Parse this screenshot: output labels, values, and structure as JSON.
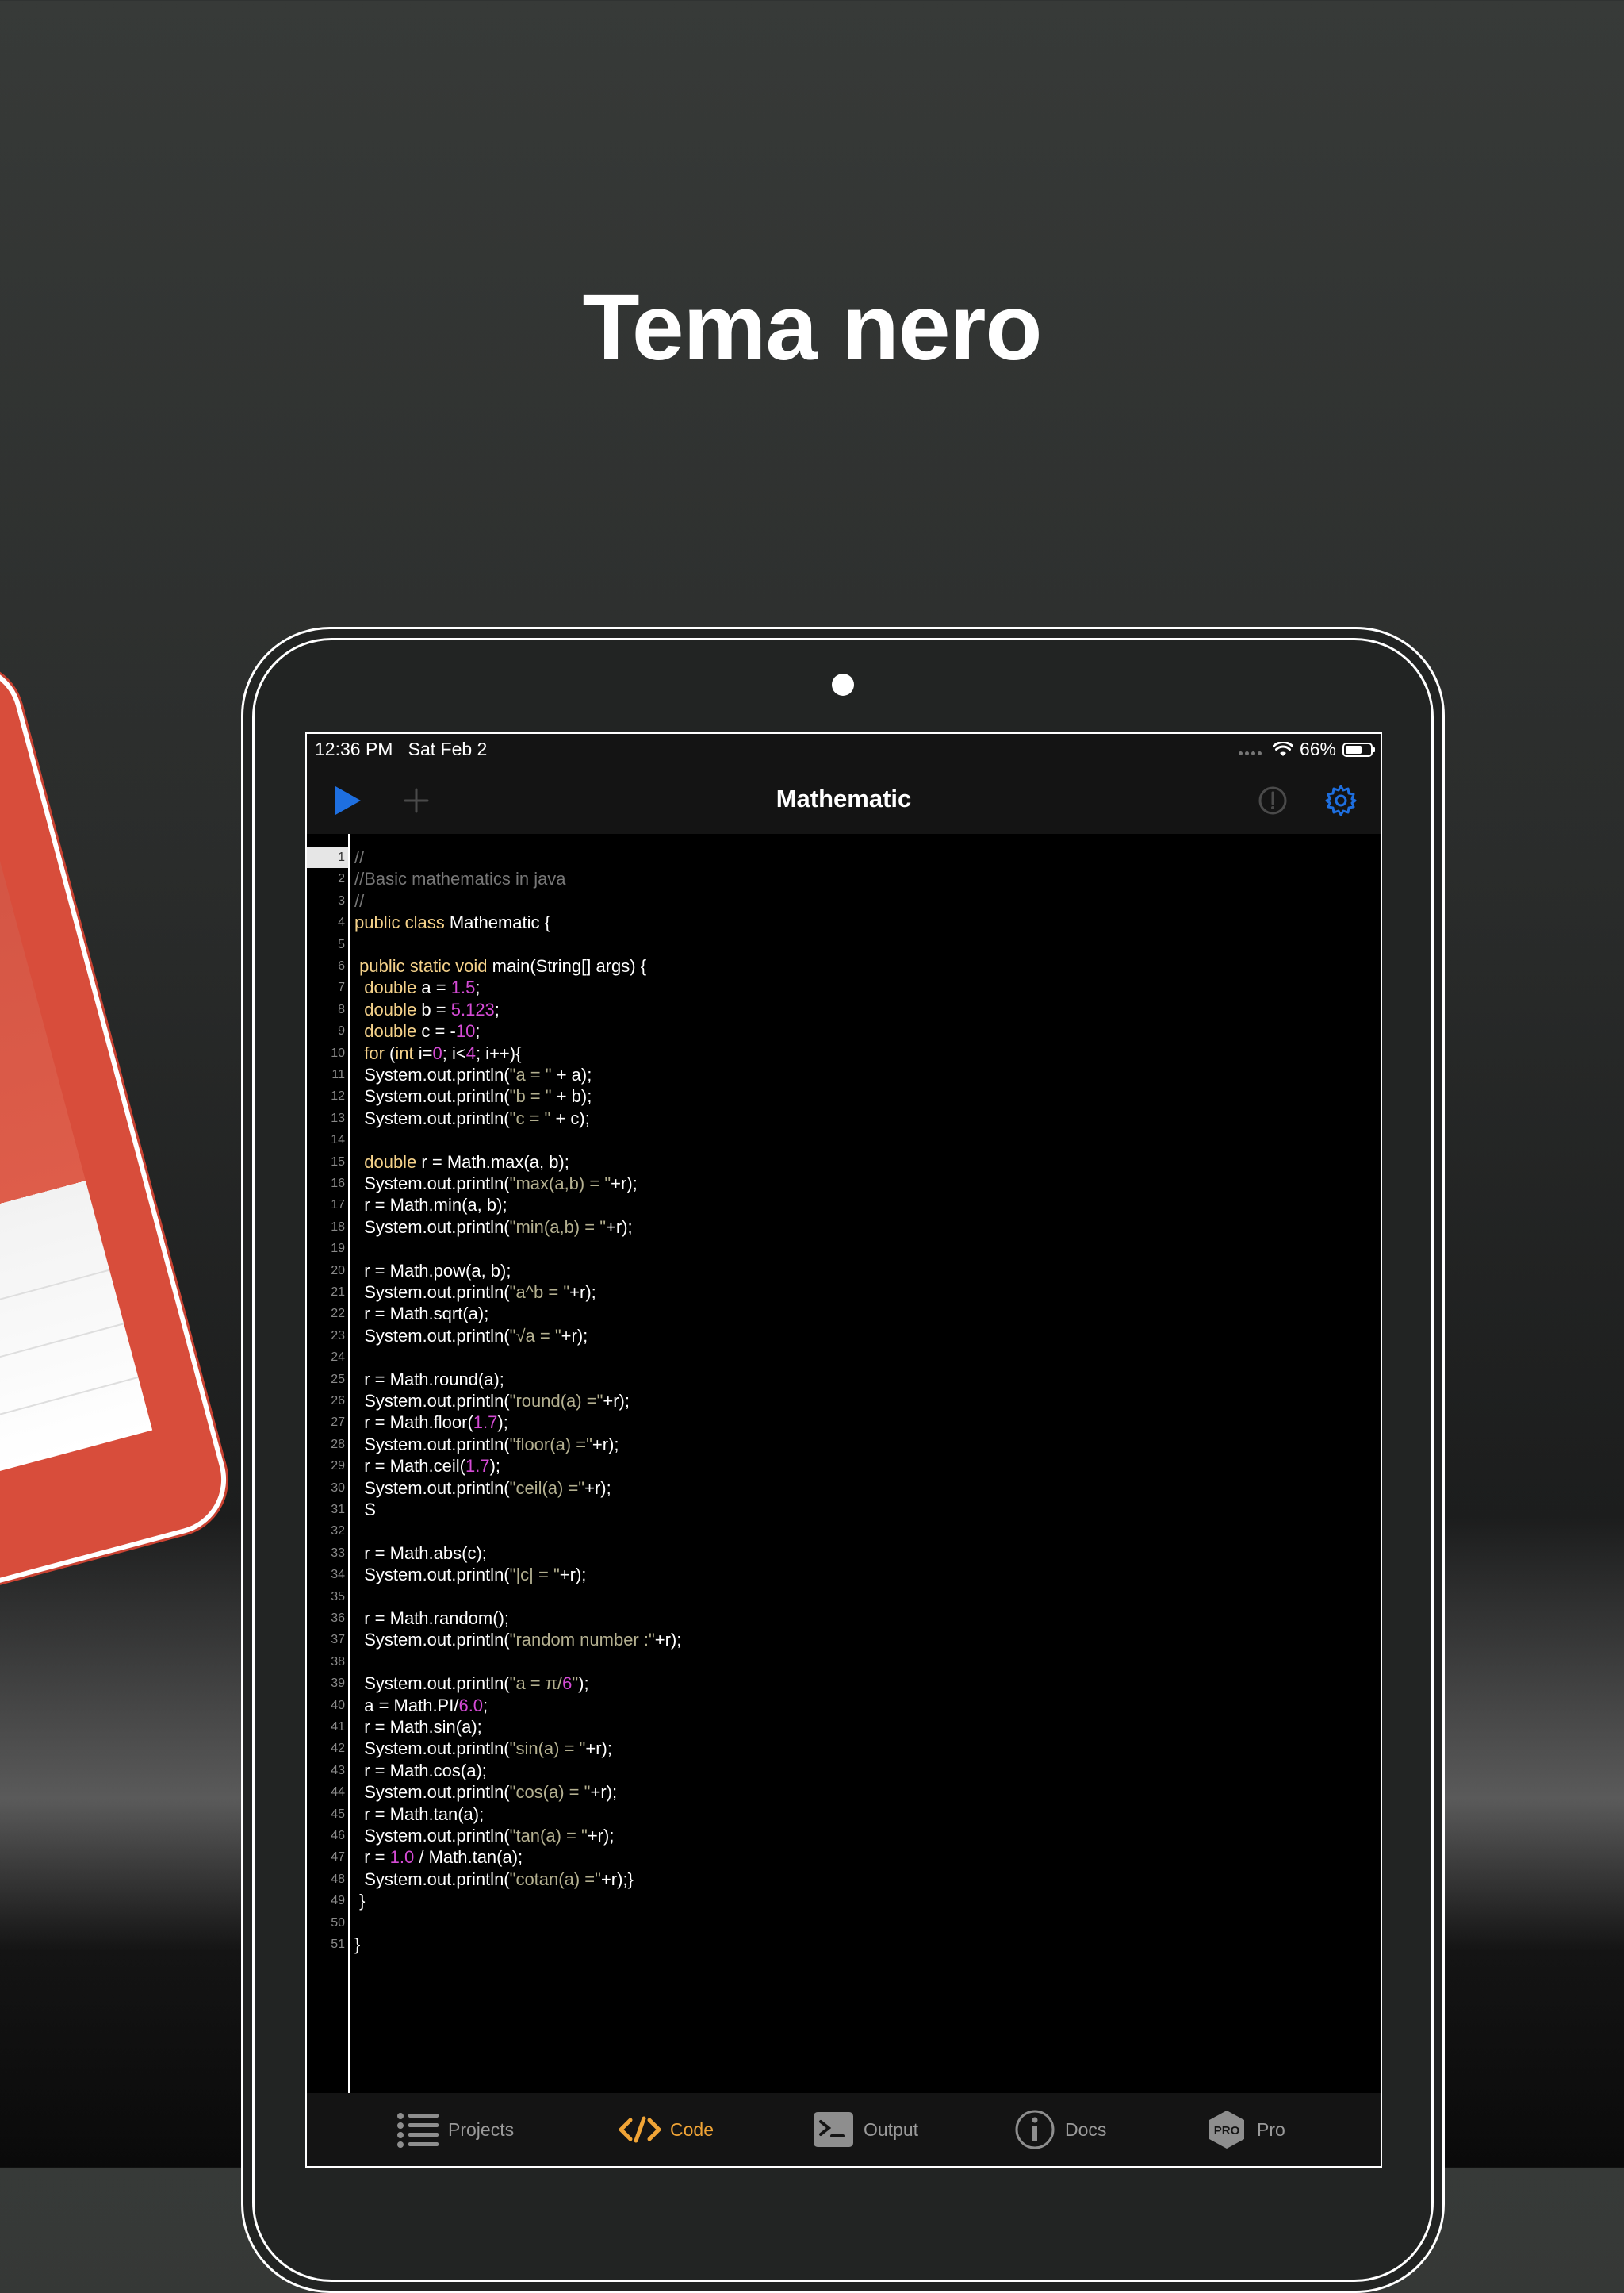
{
  "headline": "Tema nero",
  "status": {
    "time": "12:36 PM",
    "date": "Sat Feb 2",
    "battery": "66%"
  },
  "nav": {
    "title": "Mathematic"
  },
  "colors": {
    "accent_blue": "#1e6fe0",
    "active_tab": "#f0a436",
    "keyword": "#f5d28a",
    "number": "#d64bd6",
    "string": "#b4b090",
    "comment": "#777777"
  },
  "editor": {
    "active_line": 1,
    "lines": [
      "<span class='cmt'>//</span>",
      "<span class='cmt'>//Basic mathematics in java</span>",
      "<span class='cmt'>//</span>",
      "<span class='kw'>public class</span> Mathematic {",
      "",
      " <span class='kw'>public static void</span> main(String[] args) {",
      "  <span class='kw'>double</span> a = <span class='num'>1.5</span>;",
      "  <span class='kw'>double</span> b = <span class='num'>5.123</span>;",
      "  <span class='kw'>double</span> c = -<span class='num'>10</span>;",
      "  <span class='kw'>for</span> (<span class='kw'>int</span> i=<span class='num'>0</span>; i&lt;<span class='num'>4</span>; i++){",
      "  System.out.println(<span class='str'>\"a = \"</span> + a);",
      "  System.out.println(<span class='str'>\"b = \"</span> + b);",
      "  System.out.println(<span class='str'>\"c = \"</span> + c);",
      "",
      "  <span class='kw'>double</span> r = Math.max(a, b);",
      "  System.out.println(<span class='str'>\"max(a,b) = \"</span>+r);",
      "  r = Math.min(a, b);",
      "  System.out.println(<span class='str'>\"min(a,b) = \"</span>+r);",
      "",
      "  r = Math.pow(a, b);",
      "  System.out.println(<span class='str'>\"a^b = \"</span>+r);",
      "  r = Math.sqrt(a);",
      "  System.out.println(<span class='str'>\"√a = \"</span>+r);",
      "",
      "  r = Math.round(a);",
      "  System.out.println(<span class='str'>\"round(a) =\"</span>+r);",
      "  r = Math.floor(<span class='num'>1.7</span>);",
      "  System.out.println(<span class='str'>\"floor(a) =\"</span>+r);",
      "  r = Math.ceil(<span class='num'>1.7</span>);",
      "  System.out.println(<span class='str'>\"ceil(a) =\"</span>+r);",
      "  S",
      "",
      "  r = Math.abs(c);",
      "  System.out.println(<span class='str'>\"|c| = \"</span>+r);",
      "",
      "  r = Math.random();",
      "  System.out.println(<span class='str'>\"random number :\"</span>+r);",
      "",
      "  System.out.println(<span class='str'>\"a = π/</span><span class='num'>6</span><span class='str'>\"</span>);",
      "  a = Math.PI/<span class='num'>6.0</span>;",
      "  r = Math.sin(a);",
      "  System.out.println(<span class='str'>\"sin(a) = \"</span>+r);",
      "  r = Math.cos(a);",
      "  System.out.println(<span class='str'>\"cos(a) = \"</span>+r);",
      "  r = Math.tan(a);",
      "  System.out.println(<span class='str'>\"tan(a) = \"</span>+r);",
      "  r = <span class='num'>1.0</span> / Math.tan(a);",
      "  System.out.println(<span class='str'>\"cotan(a) =\"</span>+r);}",
      " }",
      "",
      "}"
    ]
  },
  "tabs": [
    {
      "name": "projects",
      "label": "Projects",
      "icon": "list-icon",
      "active": false
    },
    {
      "name": "code",
      "label": "Code",
      "icon": "code-icon",
      "active": true
    },
    {
      "name": "output",
      "label": "Output",
      "icon": "terminal-icon",
      "active": false
    },
    {
      "name": "docs",
      "label": "Docs",
      "icon": "info-icon",
      "active": false
    },
    {
      "name": "pro",
      "label": "Pro",
      "icon": "pro-badge-icon",
      "active": false
    }
  ],
  "pro_badge_text": "PRO"
}
